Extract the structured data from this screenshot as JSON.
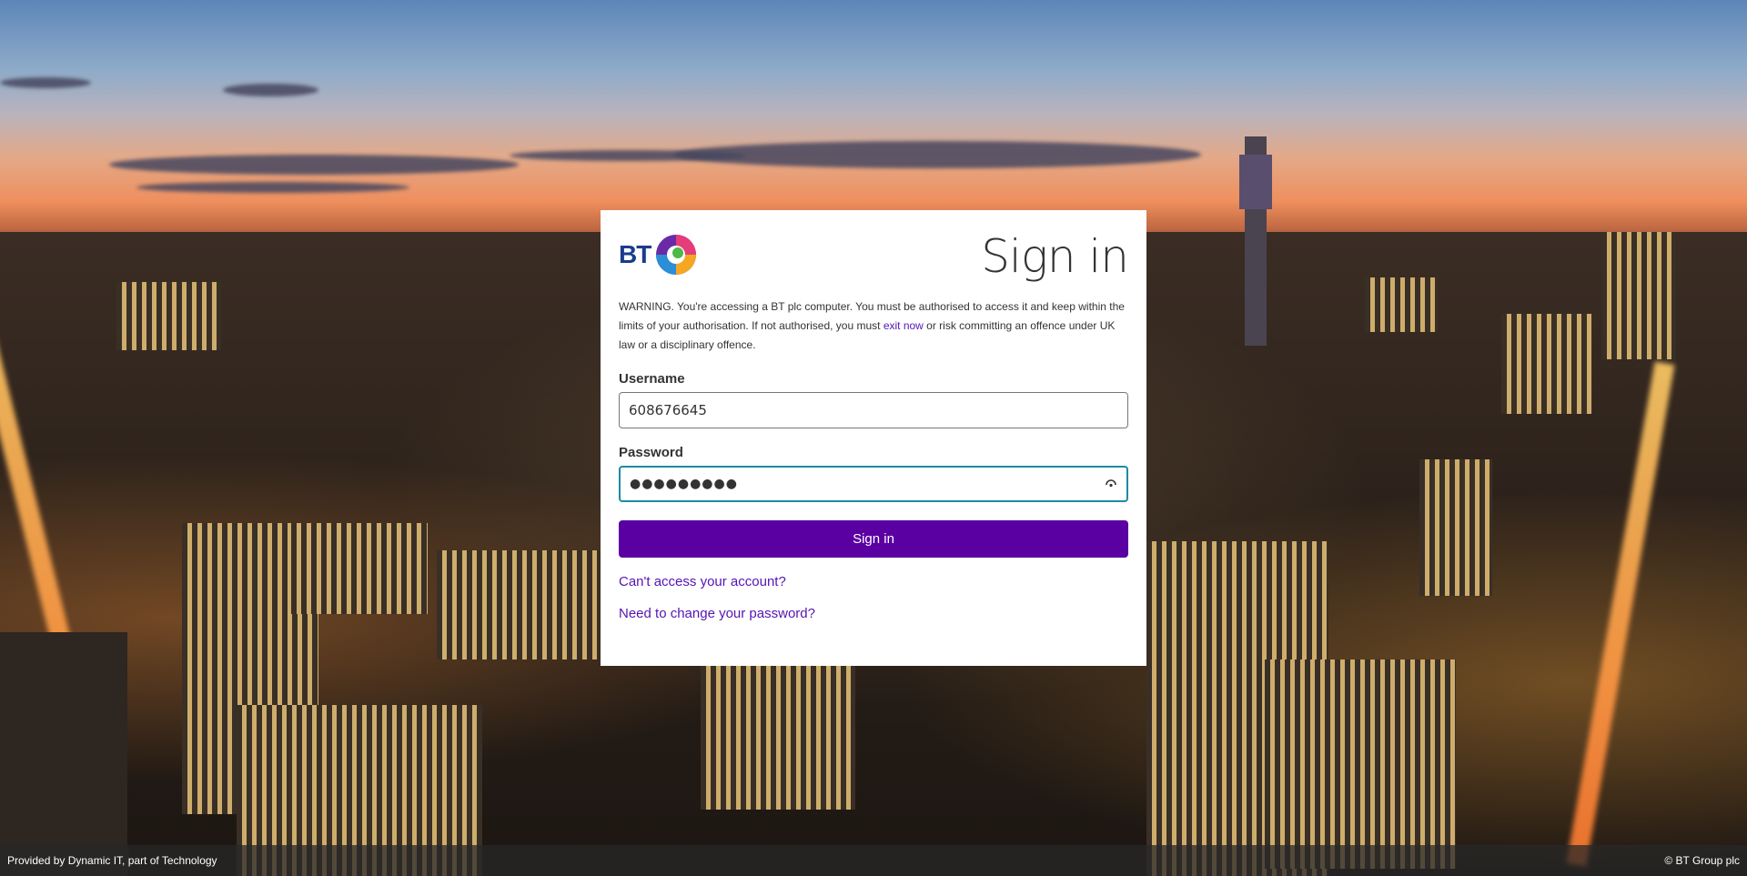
{
  "brand": {
    "logo_text": "BT",
    "icon": "bt-globe-logo"
  },
  "card": {
    "title": "Sign in",
    "warning": {
      "prefix": "WARNING. You're accessing a BT plc computer. You must be authorised to access it and keep within the limits of your authorisation. If not authorised, you must ",
      "link": "exit now",
      "suffix": " or risk committing an offence under UK law or a disciplinary offence."
    }
  },
  "form": {
    "username_label": "Username",
    "username_value": "608676645",
    "password_label": "Password",
    "password_value": "●●●●●●●●●",
    "password_icon": "eye-icon",
    "submit_label": "Sign in"
  },
  "links": {
    "cant_access": "Can't access your account?",
    "change_password": "Need to change your password?"
  },
  "footer": {
    "left": "Provided by Dynamic IT, part of Technology",
    "right": "© BT Group plc"
  },
  "colors": {
    "accent": "#5a00a3",
    "link": "#5514b4",
    "focus_border": "#1e8aa3"
  }
}
